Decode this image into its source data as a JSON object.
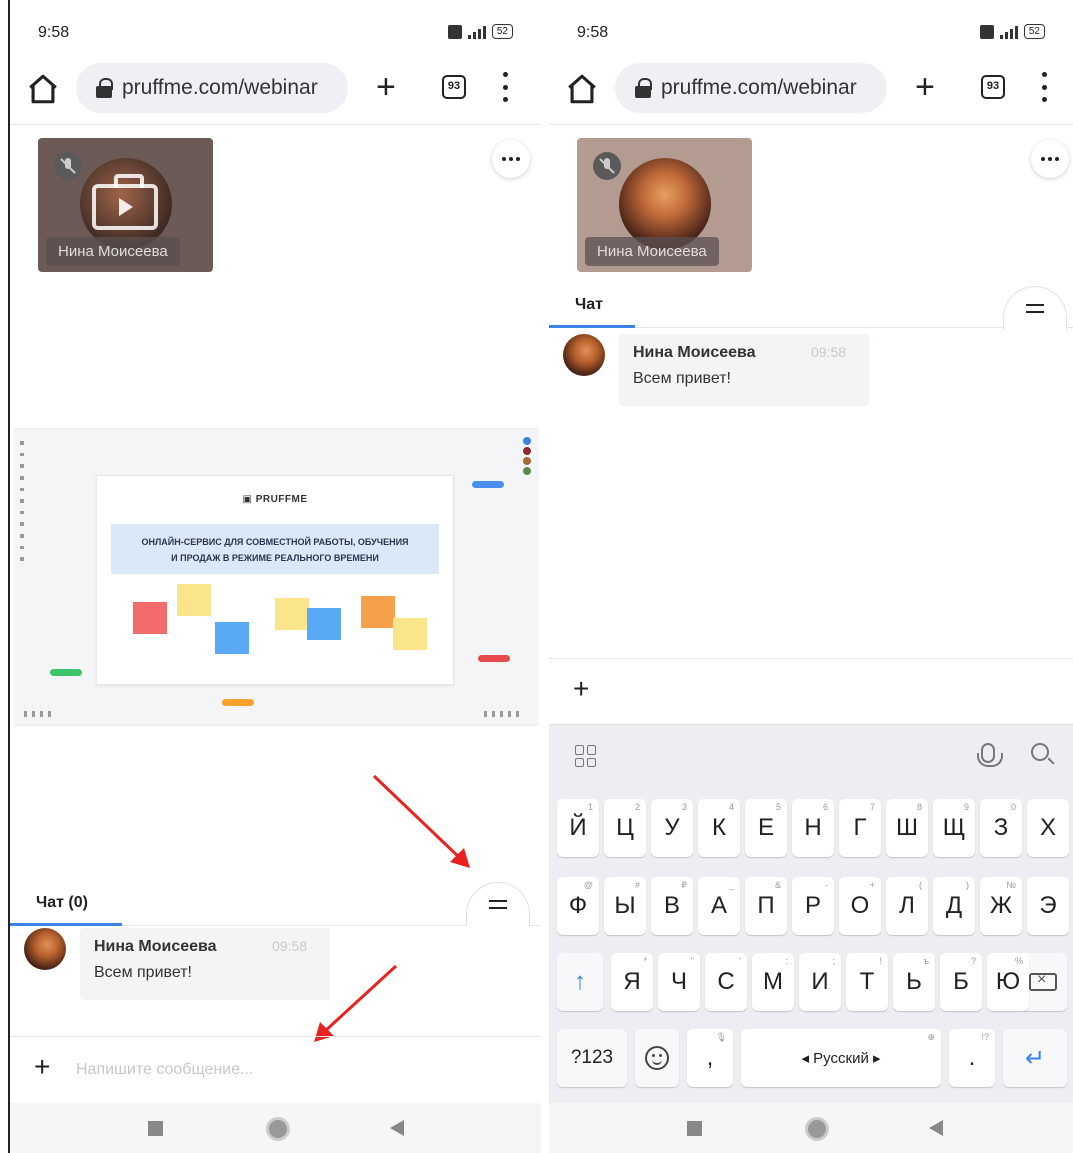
{
  "status": {
    "time": "9:58",
    "battery": "52"
  },
  "browser": {
    "url": "pruffme.com/webinar",
    "tab_count": "93"
  },
  "participant": {
    "name": "Нина Моисеева"
  },
  "board": {
    "logo": "PRUFFME",
    "headline_line1": "ОНЛАЙН-СЕРВИС ДЛЯ СОВМЕСТНОЙ РАБОТЫ, ОБУЧЕНИЯ",
    "headline_line2": "И ПРОДАЖ В РЕЖИМЕ РЕАЛЬНОГО ВРЕМЕНИ",
    "sticky_colors": [
      "#f26b6b",
      "#fbe58c",
      "#5aa9f5",
      "#fbe58c",
      "#5aa9f5",
      "#f5a04a",
      "#fbe58c"
    ],
    "pill_colors": [
      "#4a8ef0",
      "#3cc46a",
      "#e84b4b",
      "#f5a32a"
    ]
  },
  "chat_left": {
    "tab_label": "Чат (0)",
    "message": {
      "author": "Нина Моисеева",
      "time": "09:58",
      "text": "Всем привет!"
    },
    "input_placeholder": "Напишите сообщение..."
  },
  "chat_right": {
    "tab_label": "Чат",
    "message": {
      "author": "Нина Моисеева",
      "time": "09:58",
      "text": "Всем привет!"
    }
  },
  "annotation_color": "#e8231f",
  "accent_color": "#3a82e8",
  "keyboard": {
    "row1": [
      {
        "key": "Й",
        "hint": "1"
      },
      {
        "key": "Ц",
        "hint": "2"
      },
      {
        "key": "У",
        "hint": "3"
      },
      {
        "key": "К",
        "hint": "4"
      },
      {
        "key": "Е",
        "hint": "5"
      },
      {
        "key": "Н",
        "hint": "6"
      },
      {
        "key": "Г",
        "hint": "7"
      },
      {
        "key": "Ш",
        "hint": "8"
      },
      {
        "key": "Щ",
        "hint": "9"
      },
      {
        "key": "З",
        "hint": "0"
      },
      {
        "key": "Х",
        "hint": ""
      }
    ],
    "row2": [
      {
        "key": "Ф",
        "hint": "@"
      },
      {
        "key": "Ы",
        "hint": "#"
      },
      {
        "key": "В",
        "hint": "₽"
      },
      {
        "key": "А",
        "hint": "_"
      },
      {
        "key": "П",
        "hint": "&"
      },
      {
        "key": "Р",
        "hint": "-"
      },
      {
        "key": "О",
        "hint": "+"
      },
      {
        "key": "Л",
        "hint": "("
      },
      {
        "key": "Д",
        "hint": ")"
      },
      {
        "key": "Ж",
        "hint": "№"
      },
      {
        "key": "Э",
        "hint": ""
      }
    ],
    "row3": [
      {
        "key": "Я",
        "hint": "*"
      },
      {
        "key": "Ч",
        "hint": "\""
      },
      {
        "key": "С",
        "hint": "'"
      },
      {
        "key": "М",
        "hint": ":"
      },
      {
        "key": "И",
        "hint": ";"
      },
      {
        "key": "Т",
        "hint": "!"
      },
      {
        "key": "Ь",
        "hint": "ъ"
      },
      {
        "key": "Б",
        "hint": "?"
      },
      {
        "key": "Ю",
        "hint": "%"
      }
    ],
    "symbols_key": "?123",
    "comma": ",",
    "space_label": "◂ Русский ▸",
    "period": ".",
    "period_hint": "!?",
    "shift_glyph": "↑",
    "enter_glyph": "↵"
  },
  "icons": [
    "home-icon",
    "lock-icon",
    "plus-icon",
    "tabs-icon",
    "menu-icon",
    "mic-off-icon",
    "briefcase-play-icon",
    "more-icon",
    "hamburger-icon",
    "grid-icon",
    "mic-icon",
    "search-icon",
    "emoji-icon",
    "backspace-icon"
  ]
}
